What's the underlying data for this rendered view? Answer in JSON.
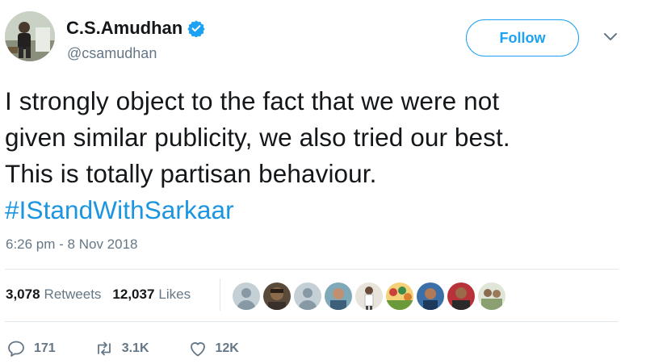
{
  "author": {
    "display_name": "C.S.Amudhan",
    "handle": "@csamudhan",
    "verified": true,
    "avatar_icon": "profile-photo"
  },
  "follow_label": "Follow",
  "menu_icon": "chevron-down-icon",
  "tweet": {
    "lines": [
      "I strongly object to the fact that we were not",
      "given similar publicity, we also tried our best.",
      "This is totally partisan behaviour."
    ],
    "hashtag": "#IStandWithSarkaar"
  },
  "timestamp": "6:26 pm - 8 Nov 2018",
  "stats": {
    "retweets_count": "3,078",
    "retweets_label": "Retweets",
    "likes_count": "12,037",
    "likes_label": "Likes"
  },
  "liker_avatars": [
    "default-avatar",
    "profile-photo",
    "default-avatar",
    "profile-photo",
    "profile-photo",
    "profile-photo",
    "profile-photo",
    "profile-photo",
    "profile-photo"
  ],
  "actions": {
    "reply_count": "171",
    "retweet_count": "3.1K",
    "like_count": "12K"
  },
  "colors": {
    "brand_blue": "#1da1f2",
    "hashtag_blue": "#1b95e0",
    "secondary_text": "#657786",
    "divider": "#e1e8ed"
  }
}
